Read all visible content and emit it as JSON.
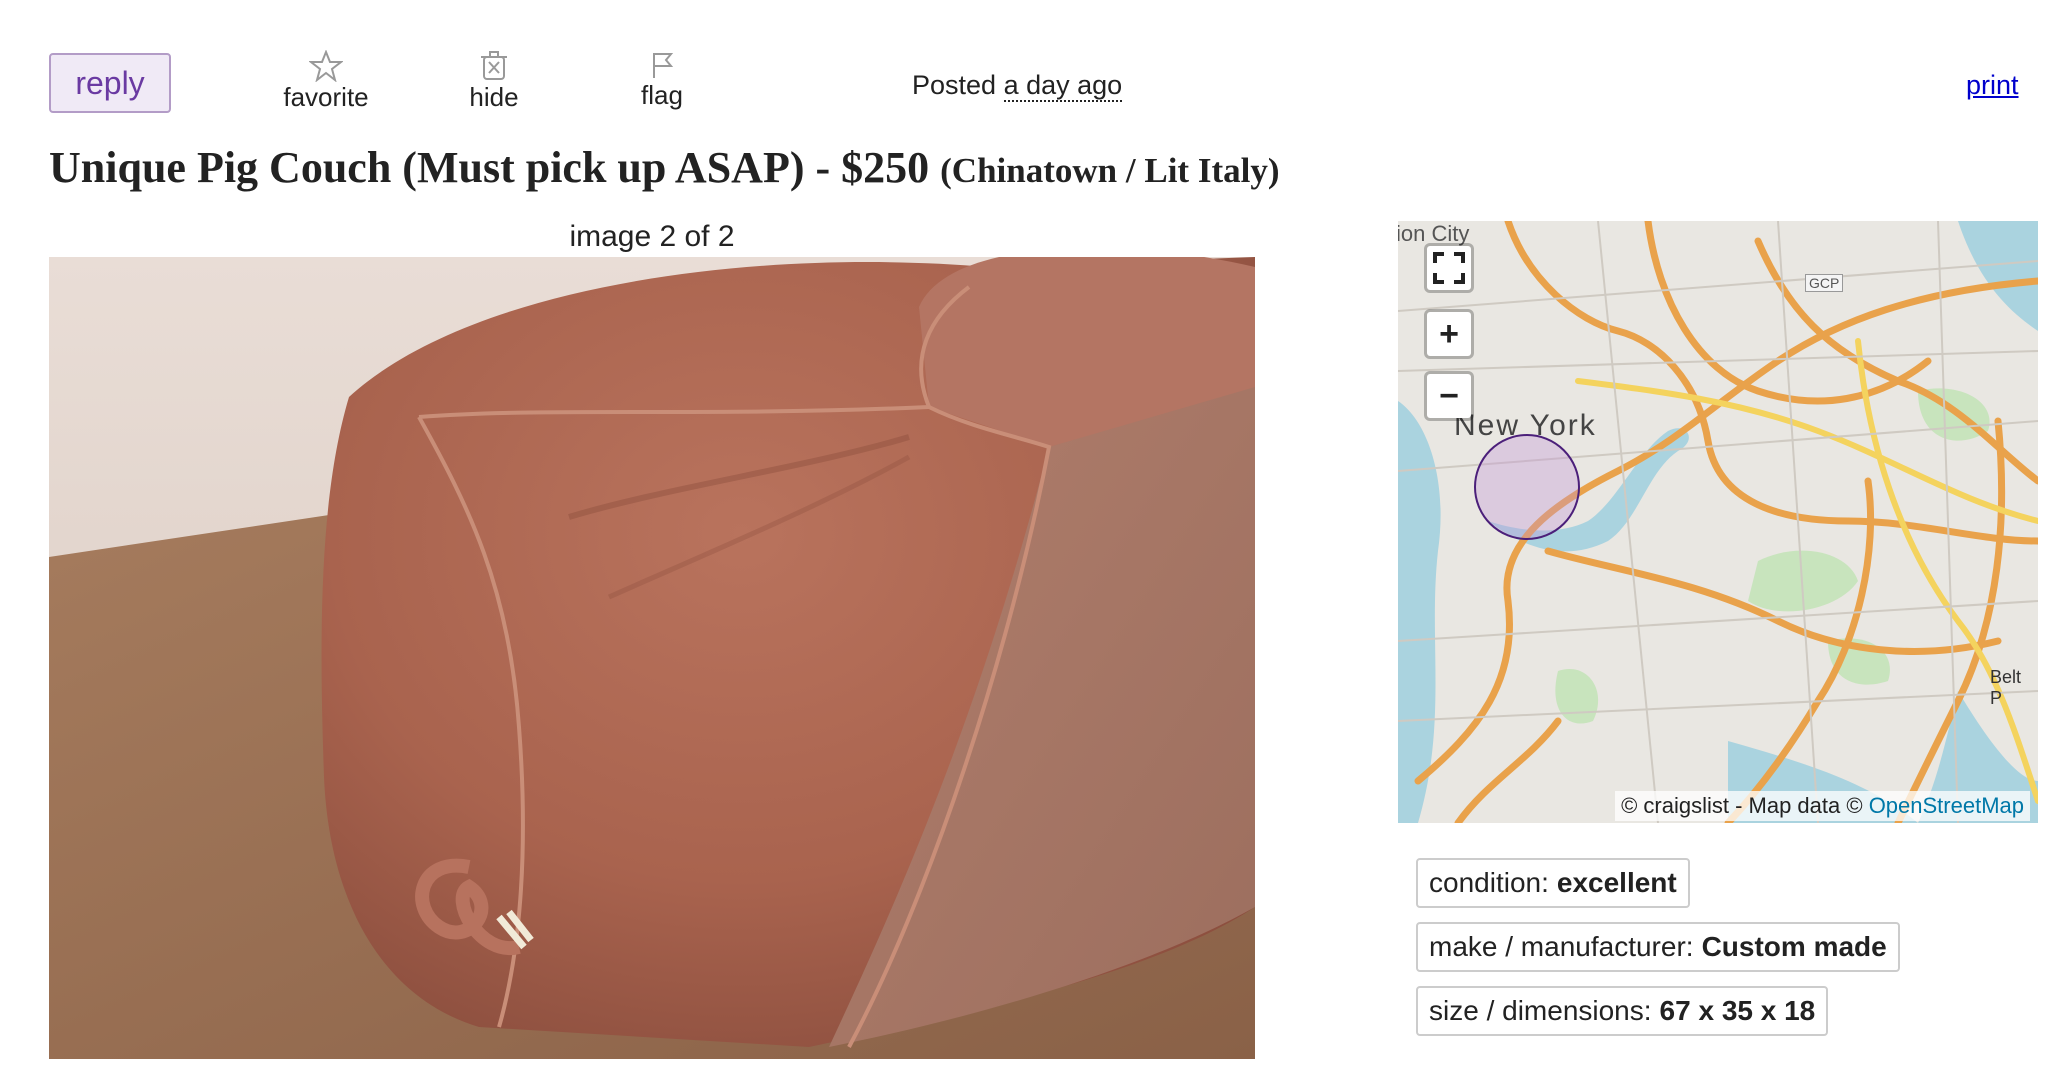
{
  "actions": {
    "reply": "reply",
    "favorite": "favorite",
    "hide": "hide",
    "flag": "flag",
    "print": "print"
  },
  "posted": {
    "prefix": "Posted",
    "ago": "a day ago"
  },
  "listing": {
    "title": "Unique Pig Couch (Must pick up ASAP) - $250",
    "location": "(Chinatown / Lit Italy)"
  },
  "gallery": {
    "caption": "image 2 of 2"
  },
  "map": {
    "label_city": "New York",
    "label_corner": "ion City",
    "label_gcp": "GCP",
    "label_belt": "Belt P",
    "zoom_in": "+",
    "zoom_out": "−",
    "attribution": "© craigslist - Map data ©",
    "attribution_link": "OpenStreetMap"
  },
  "attributes": [
    {
      "label": "condition:",
      "value": "excellent"
    },
    {
      "label": "make / manufacturer:",
      "value": "Custom made"
    },
    {
      "label": "size / dimensions:",
      "value": "67 x 35 x 18"
    }
  ],
  "icons": {
    "favorite": "star-icon",
    "hide": "trash-x-icon",
    "flag": "flag-icon",
    "fullscreen": "fullscreen-icon"
  }
}
